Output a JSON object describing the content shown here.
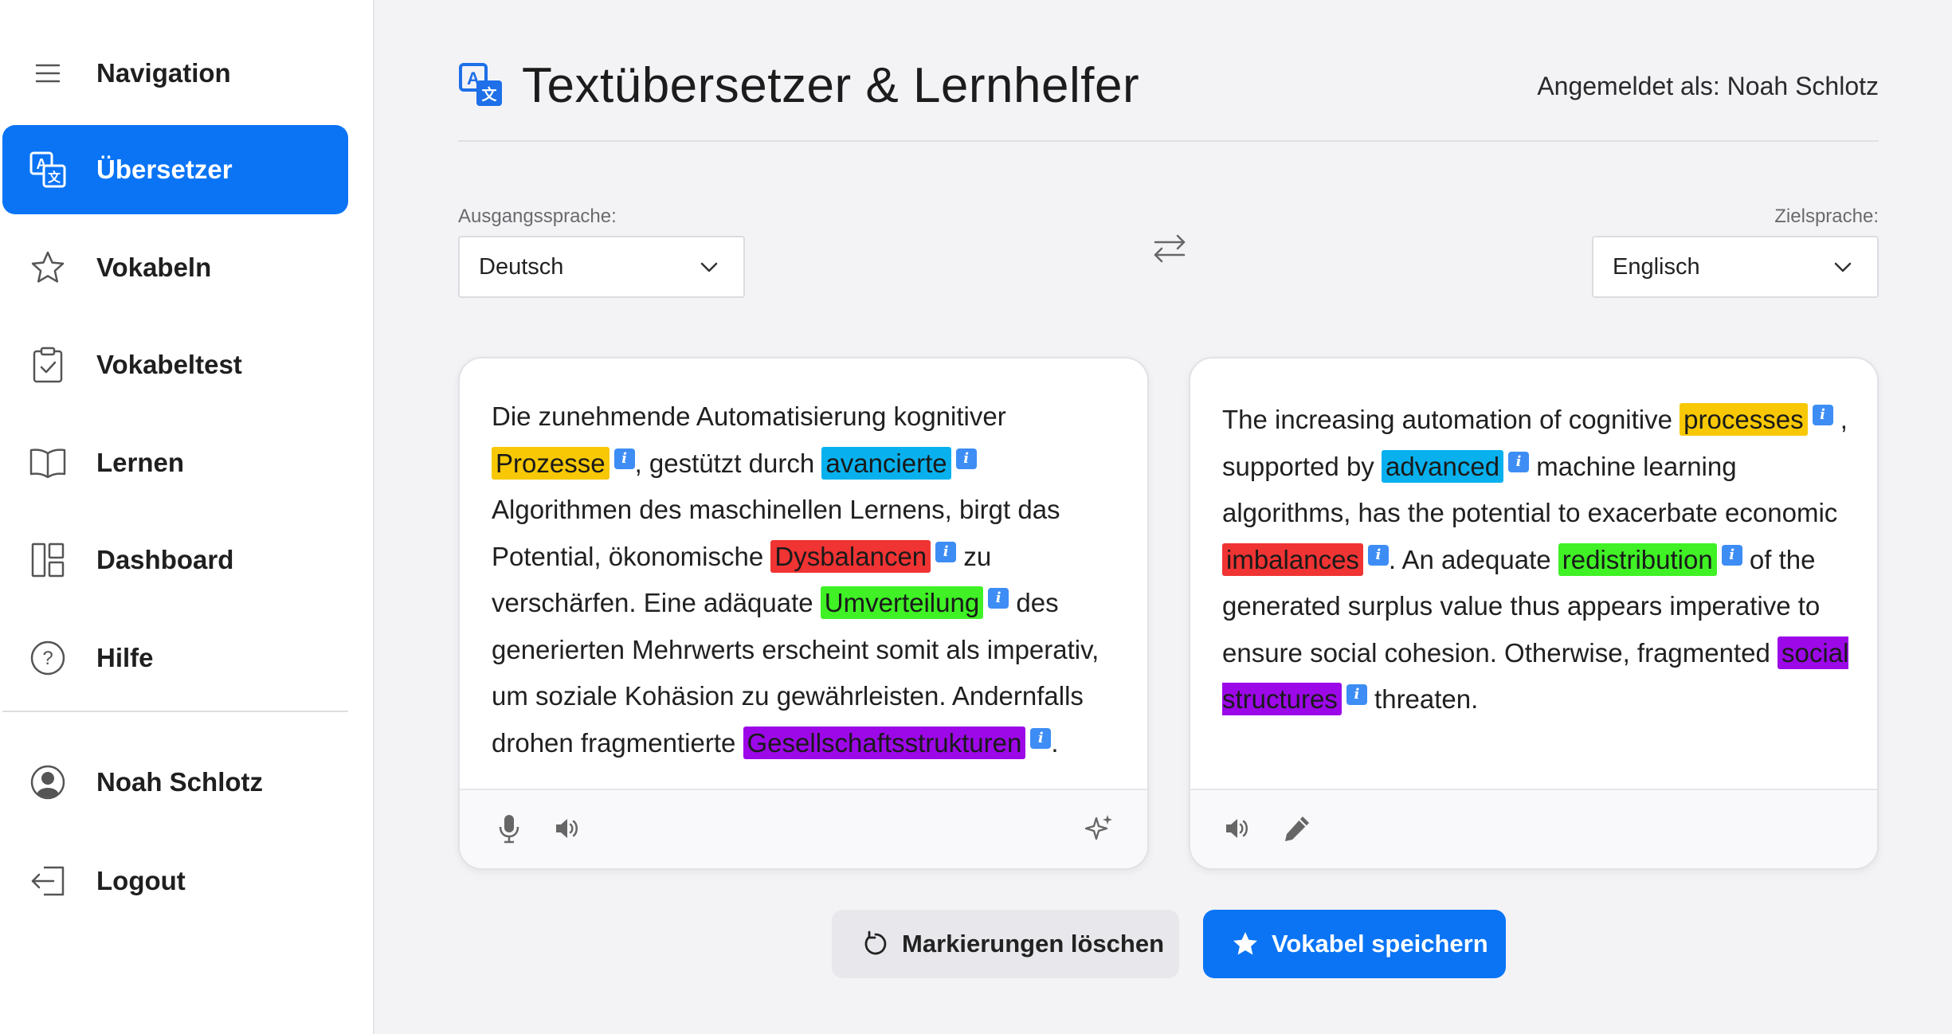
{
  "sidebar": {
    "items": [
      {
        "label": "Navigation",
        "icon": "menu-icon"
      },
      {
        "label": "Übersetzer",
        "icon": "translate-icon",
        "active": true
      },
      {
        "label": "Vokabeln",
        "icon": "star-icon"
      },
      {
        "label": "Vokabeltest",
        "icon": "clipboard-check-icon"
      },
      {
        "label": "Lernen",
        "icon": "book-icon"
      },
      {
        "label": "Dashboard",
        "icon": "dashboard-icon"
      },
      {
        "label": "Hilfe",
        "icon": "help-icon"
      },
      {
        "label": "Noah Schlotz",
        "icon": "user-icon"
      },
      {
        "label": "Logout",
        "icon": "logout-icon"
      }
    ]
  },
  "header": {
    "title": "Textübersetzer & Lernhelfer",
    "user_info": "Angemeldet als: Noah Schlotz"
  },
  "languages": {
    "source_label": "Ausgangssprache:",
    "source_value": "Deutsch",
    "target_label": "Zielsprache:",
    "target_value": "Englisch"
  },
  "source_text": {
    "t1": "Die zunehmende Automatisierung kognitiver ",
    "h1": "Prozesse",
    "t2": ", gestützt durch ",
    "h2": "avancierte",
    "t3": " Algorithmen des maschinellen Lernens, birgt das Potential, ökonomische ",
    "h3": "Dysbalancen",
    "t4": " zu verschärfen. Eine adäquate ",
    "h4": "Umverteilung",
    "t5": " des generierten Mehrwerts erscheint somit als imperativ, um soziale Kohäsion zu gewährleisten. Andernfalls drohen fragmentierte ",
    "h5": "Gesellschaftsstrukturen",
    "t6": "."
  },
  "target_text": {
    "t1": "The increasing automation of cognitive ",
    "h1": "processes",
    "t2": " , supported by ",
    "h2": "advanced",
    "t3": " machine learning algorithms, has the potential to exacerbate economic ",
    "h3": "imbalances",
    "t4": ". An adequate ",
    "h4": "redistribution",
    "t5": " of the generated surplus value thus appears imperative to ensure social cohesion. Otherwise, fragmented ",
    "h5": "social structures",
    "t6": " threaten."
  },
  "info_glyph": "i",
  "highlight_colors": {
    "yellow": "#f7c803",
    "blue": "#08b1ee",
    "red": "#f03333",
    "green": "#3ff125",
    "purple": "#9c08e8"
  },
  "accent_color": "#0a74f5",
  "actions": {
    "clear_label": "Markierungen löschen",
    "save_label": "Vokabel speichern"
  }
}
